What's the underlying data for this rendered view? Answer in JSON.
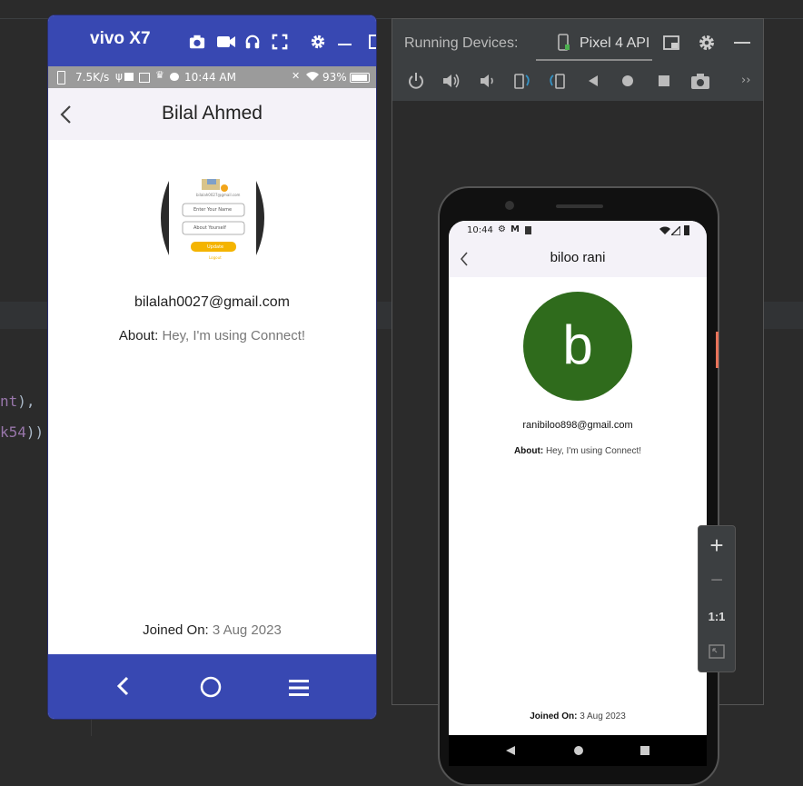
{
  "ide": {
    "code_line_1_a": "nt",
    "code_line_1_b": "),",
    "code_line_2_a": "k54",
    "code_line_2_b": "))"
  },
  "vivo": {
    "window_title": "vivo X7",
    "status": {
      "speed": "7.5K/s",
      "time": "10:44 AM",
      "battery": "93%"
    },
    "appbar_title": "Bilal Ahmed",
    "email": "bilalah0027@gmail.com",
    "about_label": "About: ",
    "about_value": "Hey, I'm using Connect!",
    "joined_label": "Joined On: ",
    "joined_value": "3 Aug 2023",
    "thumb": {
      "email": "bilalah0027@gmail.com",
      "name_placeholder": "Enter Your Name",
      "about_placeholder": "About Yourself",
      "update_label": "Update",
      "logout_label": "Logout"
    }
  },
  "running_devices": {
    "title": "Running Devices:",
    "tab_label": "Pixel 4 API",
    "pixel": {
      "status_time": "10:44",
      "appbar_title": "biloo rani",
      "avatar_letter": "b",
      "email": "ranibiloo898@gmail.com",
      "about_label": "About: ",
      "about_value": "Hey, I'm using Connect!",
      "joined_label": "Joined On: ",
      "joined_value": "3 Aug 2023"
    }
  },
  "zoom": {
    "plus": "+",
    "minus": "−",
    "one_to_one": "1:1"
  },
  "colors": {
    "vivo_accent": "#3848b2",
    "avatar_bg": "#2f6b1c",
    "ide_bg": "#2b2b2b"
  }
}
